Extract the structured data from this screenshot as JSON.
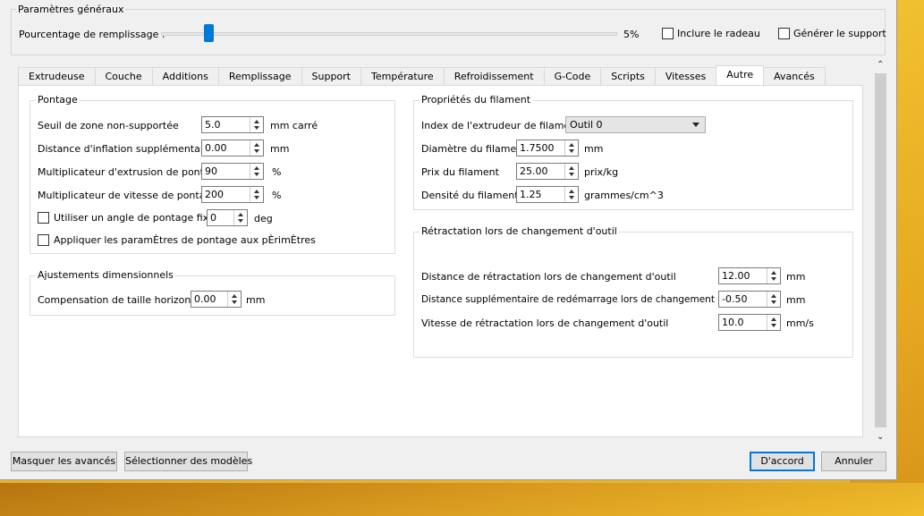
{
  "general": {
    "title": "Paramètres généraux",
    "fill_label": "Pourcentage de remplissage :",
    "fill_value": "5%",
    "fill_fraction": 0.05,
    "raft_label": "Inclure le radeau",
    "raft_checked": false,
    "support_label": "Générer le support",
    "support_checked": false
  },
  "tabs": [
    {
      "label": "Extrudeuse"
    },
    {
      "label": "Couche"
    },
    {
      "label": "Additions"
    },
    {
      "label": "Remplissage"
    },
    {
      "label": "Support"
    },
    {
      "label": "Température"
    },
    {
      "label": "Refroidissement"
    },
    {
      "label": "G-Code"
    },
    {
      "label": "Scripts"
    },
    {
      "label": "Vitesses"
    },
    {
      "label": "Autre"
    },
    {
      "label": "Avancés"
    }
  ],
  "active_tab": "Autre",
  "bridging": {
    "title": "Pontage",
    "rows": [
      {
        "label": "Seuil de zone non-supportée",
        "value": "5.0",
        "unit": "mm carré"
      },
      {
        "label": "Distance d'inflation supplémentaire",
        "value": "0.00",
        "unit": "mm"
      },
      {
        "label": "Multiplicateur d'extrusion de pontage",
        "value": "90",
        "unit": "%"
      },
      {
        "label": "Multiplicateur de vitesse de pontage",
        "value": "200",
        "unit": "%"
      }
    ],
    "fixed_angle_label": "Utiliser un angle de pontage fixe.",
    "fixed_angle_value": "0",
    "fixed_angle_unit": "deg",
    "perimeters_label": "Appliquer les paramÈtres de pontage aux pÈrimÈtres"
  },
  "dimensional": {
    "title": "Ajustements dimensionnels",
    "label": "Compensation de taille horizontale",
    "value": "0.00",
    "unit": "mm"
  },
  "filament": {
    "title": "Propriétés du filament",
    "extruder_label": "Index de l'extrudeur de filament",
    "extruder_value": "Outil 0",
    "rows": [
      {
        "label": "Diamètre du filament",
        "value": "1.7500",
        "unit": "mm"
      },
      {
        "label": "Prix du filament",
        "value": "25.00",
        "unit": "prix/kg"
      },
      {
        "label": "Densité du filament",
        "value": "1.25",
        "unit": "grammes/cm^3"
      }
    ]
  },
  "retraction": {
    "title": "Rétractation lors de changement d'outil",
    "rows": [
      {
        "label": "Distance de rétractation lors de changement d'outil",
        "value": "12.00",
        "unit": "mm"
      },
      {
        "label": "Distance supplémentaire de redémarrage lors de changement d'outil",
        "value": "-0.50",
        "unit": "mm"
      },
      {
        "label": "Vitesse de rétractation lors de changement d'outil",
        "value": "10.0",
        "unit": "mm/s"
      }
    ]
  },
  "buttons": {
    "hide_advanced": "Masquer les avancés",
    "select_models": "Sélectionner des modèles",
    "ok": "D'accord",
    "cancel": "Annuler"
  },
  "colors": {
    "accent": "#0078d7",
    "desktop": "#e9b528"
  }
}
